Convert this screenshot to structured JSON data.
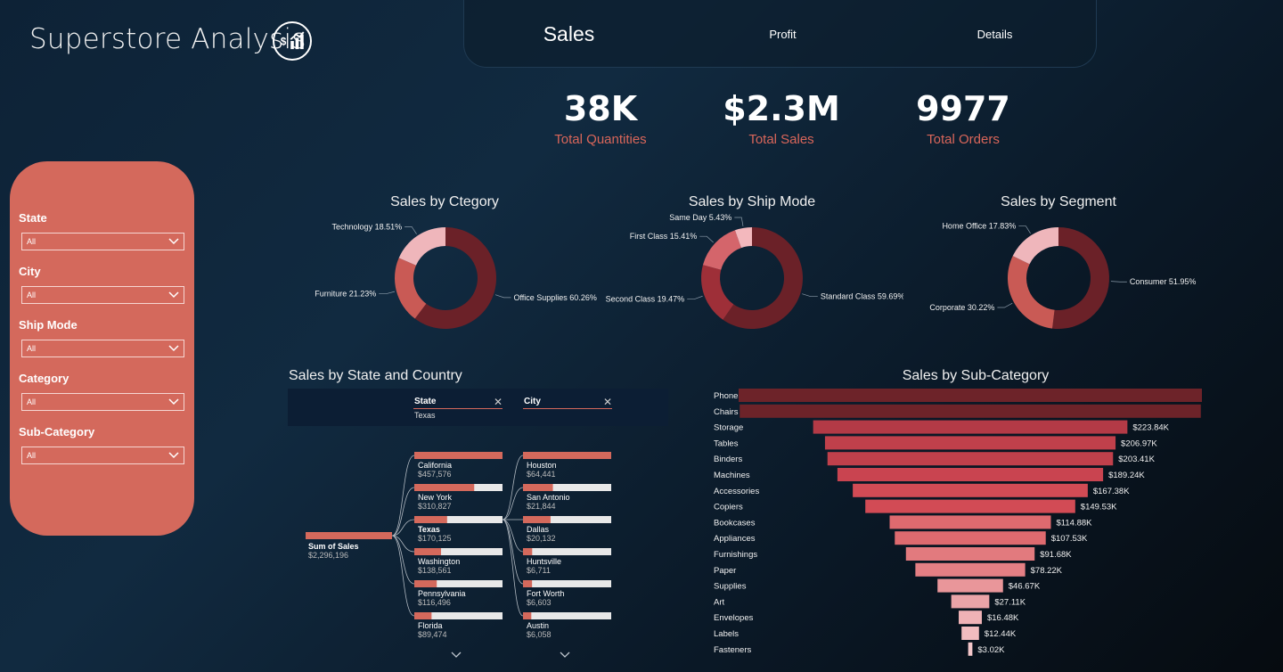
{
  "header": {
    "title": "Superstore Analysis",
    "logo_icon": "sales-chart-icon"
  },
  "nav": {
    "tabs": [
      "Sales",
      "Profit",
      "Details"
    ],
    "active": "Sales"
  },
  "kpis": [
    {
      "value": "38K",
      "label": "Total Quantities"
    },
    {
      "value": "$2.3M",
      "label": "Total Sales"
    },
    {
      "value": "9977",
      "label": "Total Orders"
    }
  ],
  "filters": [
    {
      "label": "State",
      "value": "All"
    },
    {
      "label": "City",
      "value": "All"
    },
    {
      "label": "Ship Mode",
      "value": "All"
    },
    {
      "label": "Category",
      "value": "All"
    },
    {
      "label": "Sub-Category",
      "value": "All"
    }
  ],
  "colors": {
    "accent": "#d4695c",
    "dark_red": "#6b2128",
    "mid_red": "#c84a52",
    "pink": "#efb6bb"
  },
  "chart_data": [
    {
      "type": "pie",
      "title": "Sales by Ctegory",
      "slices": [
        {
          "label": "Office Supplies 60.26%",
          "value": 60.26,
          "color": "#6b2128"
        },
        {
          "label": "Furniture 21.23%",
          "value": 21.23,
          "color": "#c95a55"
        },
        {
          "label": "Technology 18.51%",
          "value": 18.51,
          "color": "#efb6bb"
        }
      ]
    },
    {
      "type": "pie",
      "title": "Sales by Ship Mode",
      "slices": [
        {
          "label": "Standard Class 59.69%",
          "value": 59.69,
          "color": "#6b2128"
        },
        {
          "label": "Second Class 19.47%",
          "value": 19.47,
          "color": "#9e2f38"
        },
        {
          "label": "First Class 15.41%",
          "value": 15.41,
          "color": "#d4656b"
        },
        {
          "label": "Same Day 5.43%",
          "value": 5.43,
          "color": "#f3b8bd"
        }
      ]
    },
    {
      "type": "pie",
      "title": "Sales by Segment",
      "slices": [
        {
          "label": "Consumer 51.95%",
          "value": 51.95,
          "color": "#6b2128"
        },
        {
          "label": "Corporate 30.22%",
          "value": 30.22,
          "color": "#c95a55"
        },
        {
          "label": "Home Office 17.83%",
          "value": 17.83,
          "color": "#efb6bb"
        }
      ]
    },
    {
      "type": "bar",
      "title": "Sales by Sub-Category",
      "categories": [
        "Phones",
        "Chairs",
        "Storage",
        "Tables",
        "Binders",
        "Machines",
        "Accessories",
        "Copiers",
        "Bookcases",
        "Appliances",
        "Furnishings",
        "Paper",
        "Supplies",
        "Art",
        "Envelopes",
        "Labels",
        "Fasteners"
      ],
      "values": [
        330.01,
        328.45,
        223.84,
        206.97,
        203.41,
        189.24,
        167.38,
        149.53,
        114.88,
        107.53,
        91.68,
        78.22,
        46.67,
        27.11,
        16.48,
        12.44,
        3.02
      ],
      "data_labels": [
        "",
        "",
        "$223.84K",
        "$206.97K",
        "$203.41K",
        "$189.24K",
        "$167.38K",
        "$149.53K",
        "$114.88K",
        "$107.53K",
        "$91.68K",
        "$78.22K",
        "$46.67K",
        "$27.11K",
        "$16.48K",
        "$12.44K",
        "$3.02K"
      ],
      "colors": [
        "#6d2329",
        "#6d2329",
        "#b33a46",
        "#c0404b",
        "#c0404b",
        "#c94450",
        "#d24b55",
        "#d24b55",
        "#de6a6f",
        "#de6a6f",
        "#e27a7e",
        "#e47f84",
        "#e9969a",
        "#eaa4a8",
        "#efb2b6",
        "#f1bcbf",
        "#f3c6c9"
      ],
      "unit": "K"
    },
    {
      "type": "decomposition-tree",
      "title": "Sales by State and Country",
      "levels": [
        "State",
        "City"
      ],
      "selected_state": "Texas",
      "root": {
        "label": "Sum of Sales",
        "value": "$2,296,196"
      },
      "states": [
        {
          "name": "California",
          "value": "$457,576",
          "amount": 457576
        },
        {
          "name": "New York",
          "value": "$310,827",
          "amount": 310827
        },
        {
          "name": "Texas",
          "value": "$170,125",
          "amount": 170125
        },
        {
          "name": "Washington",
          "value": "$138,561",
          "amount": 138561
        },
        {
          "name": "Pennsylvania",
          "value": "$116,496",
          "amount": 116496
        },
        {
          "name": "Florida",
          "value": "$89,474",
          "amount": 89474
        }
      ],
      "cities": [
        {
          "name": "Houston",
          "value": "$64,441",
          "amount": 64441
        },
        {
          "name": "San Antonio",
          "value": "$21,844",
          "amount": 21844
        },
        {
          "name": "Dallas",
          "value": "$20,132",
          "amount": 20132
        },
        {
          "name": "Huntsville",
          "value": "$6,711",
          "amount": 6711
        },
        {
          "name": "Fort Worth",
          "value": "$6,603",
          "amount": 6603
        },
        {
          "name": "Austin",
          "value": "$6,058",
          "amount": 6058
        }
      ]
    }
  ]
}
